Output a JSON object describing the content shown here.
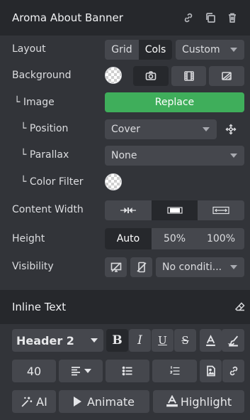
{
  "header": {
    "title": "Aroma About Banner",
    "icons": [
      "link-icon",
      "copy-icon",
      "trash-icon"
    ]
  },
  "layout": {
    "label": "Layout",
    "options": [
      "Grid",
      "Cols"
    ],
    "selected": "Cols",
    "select_value": "Custom"
  },
  "background": {
    "label": "Background",
    "types": [
      "camera-icon",
      "film-icon",
      "gradient-icon"
    ],
    "selected": "camera-icon"
  },
  "image": {
    "label": "Image",
    "button": "Replace"
  },
  "position": {
    "label": "Position",
    "value": "Cover"
  },
  "parallax": {
    "label": "Parallax",
    "value": "None"
  },
  "color_filter": {
    "label": "Color Filter"
  },
  "content_width": {
    "label": "Content Width",
    "options": [
      "shrink-icon",
      "boxed-icon",
      "expand-icon"
    ],
    "selected": "boxed-icon"
  },
  "height": {
    "label": "Height",
    "options": [
      "Auto",
      "50%",
      "100%"
    ],
    "selected": "Auto"
  },
  "visibility": {
    "label": "Visibility",
    "value": "No conditi..."
  },
  "inline_text": {
    "title": "Inline Text",
    "heading": "Header 2",
    "format": [
      "B",
      "I",
      "U",
      "S"
    ],
    "font_size": "40",
    "ai": "AI",
    "animate": "Animate",
    "highlight": "Highlight"
  },
  "colors": {
    "accent_green": "#3fae5b",
    "panel": "#323439",
    "header": "#26282c",
    "control": "#45474d"
  }
}
